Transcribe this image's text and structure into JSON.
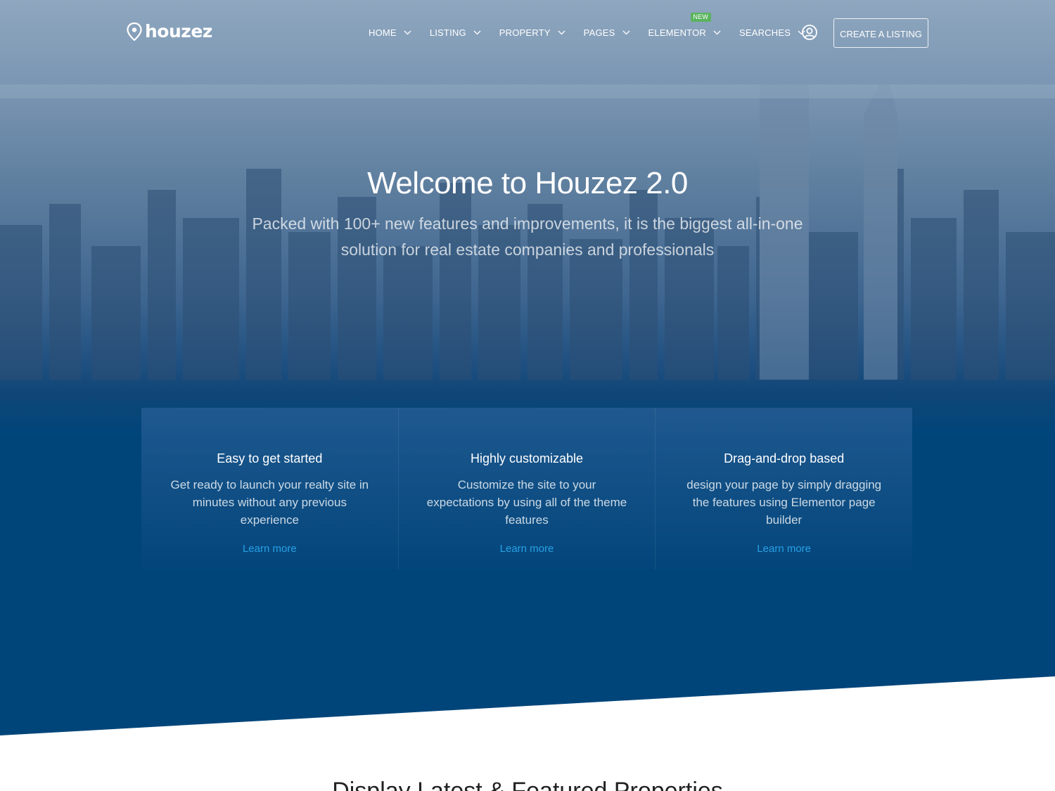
{
  "header": {
    "logo_text": "houzez",
    "nav": [
      {
        "label": "HOME"
      },
      {
        "label": "LISTING"
      },
      {
        "label": "PROPERTY"
      },
      {
        "label": "PAGES"
      },
      {
        "label": "ELEMENTOR",
        "badge": "NEW"
      },
      {
        "label": "SEARCHES"
      }
    ],
    "create_listing_label": "CREATE A LISTING"
  },
  "hero": {
    "title": "Welcome to Houzez 2.0",
    "subtitle": "Packed with 100+ new features and improvements, it is the biggest all-in-one solution for real estate companies and professionals"
  },
  "cards": [
    {
      "title": "Easy to get started",
      "text": "Get ready to launch your realty site in minutes without any previous experience",
      "link": "Learn more"
    },
    {
      "title": "Highly customizable",
      "text": "Customize the site to your expectations by using all of the theme features",
      "link": "Learn more"
    },
    {
      "title": "Drag-and-drop based",
      "text": "design your page by simply dragging the features using Elementor page builder",
      "link": "Learn more"
    }
  ],
  "section": {
    "title": "Display Latest & Featured Properties"
  },
  "colors": {
    "hero_blue": "#00457a",
    "link_blue": "#27a0e6",
    "badge_green": "#5ab45f"
  }
}
